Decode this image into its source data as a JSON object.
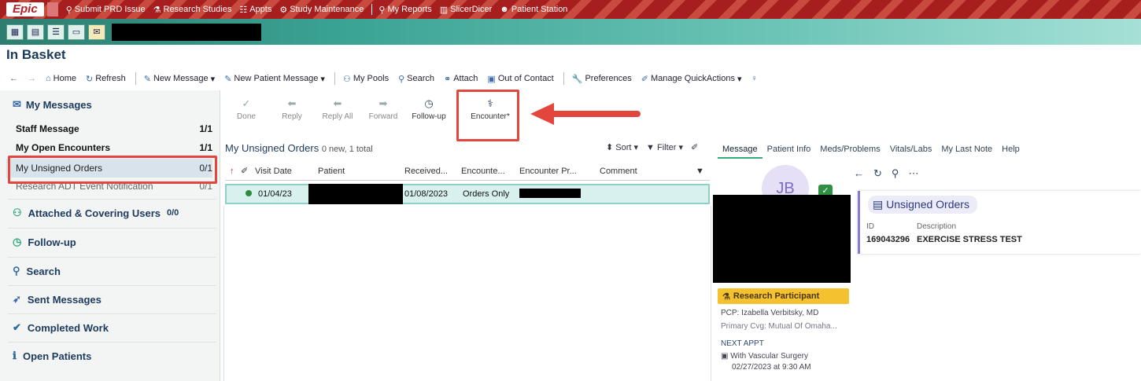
{
  "topbar": {
    "logo": "Epic",
    "items": [
      "Submit PRD Issue",
      "Research Studies",
      "Appts",
      "Study Maintenance",
      "My Reports",
      "SlicerDicer",
      "Patient Station"
    ]
  },
  "page_title": "In Basket",
  "toolbar": {
    "home": "Home",
    "refresh": "Refresh",
    "new_message": "New Message",
    "new_patient_message": "New Patient Message",
    "my_pools": "My Pools",
    "search": "Search",
    "attach": "Attach",
    "out_of_contact": "Out of Contact",
    "preferences": "Preferences",
    "manage_quickactions": "Manage QuickActions"
  },
  "sidebar": {
    "header": "My Messages",
    "rows": [
      {
        "label": "Staff Message",
        "count": "1/1"
      },
      {
        "label": "My Open Encounters",
        "count": "1/1"
      },
      {
        "label": "My Unsigned Orders",
        "count": "0/1"
      },
      {
        "label": "Research ADT Event Notification",
        "count": "0/1"
      }
    ],
    "sections": [
      {
        "label": "Attached & Covering Users",
        "count": "0/0"
      },
      {
        "label": "Follow-up"
      },
      {
        "label": "Search"
      },
      {
        "label": "Sent Messages"
      },
      {
        "label": "Completed Work"
      },
      {
        "label": "Open Patients"
      }
    ]
  },
  "actions": {
    "done": "Done",
    "reply": "Reply",
    "reply_all": "Reply All",
    "forward": "Forward",
    "follow_up": "Follow-up",
    "encounter": "Encounter*"
  },
  "list": {
    "title": "My Unsigned Orders",
    "summary": "0 new, 1 total",
    "sort": "Sort",
    "filter": "Filter",
    "columns": [
      "Visit Date",
      "Patient",
      "Received...",
      "Encounte...",
      "Encounter Pr...",
      "Comment"
    ],
    "row": {
      "visit_date": "01/04/23",
      "received": "01/08/2023",
      "encounter": "Orders Only"
    }
  },
  "right": {
    "tabs": [
      "Message",
      "Patient Info",
      "Meds/Problems",
      "Vitals/Labs",
      "My Last Note",
      "Help"
    ],
    "avatar_initials": "JB",
    "card_title": "Unsigned Orders",
    "id_label": "ID",
    "desc_label": "Description",
    "order_id": "169043296",
    "order_desc": "EXERCISE STRESS TEST",
    "research_badge": "Research Participant",
    "pcp": "PCP: Izabella Verbitsky, MD",
    "coverage": "Primary Cvg: Mutual Of Omaha...",
    "next_appt_label": "NEXT APPT",
    "appt_line1": "With Vascular Surgery",
    "appt_line2": "02/27/2023 at 9:30 AM"
  },
  "colors": {
    "accent_red": "#e3463d",
    "teal": "#3aa394",
    "selected_row": "#d9f1ee"
  }
}
